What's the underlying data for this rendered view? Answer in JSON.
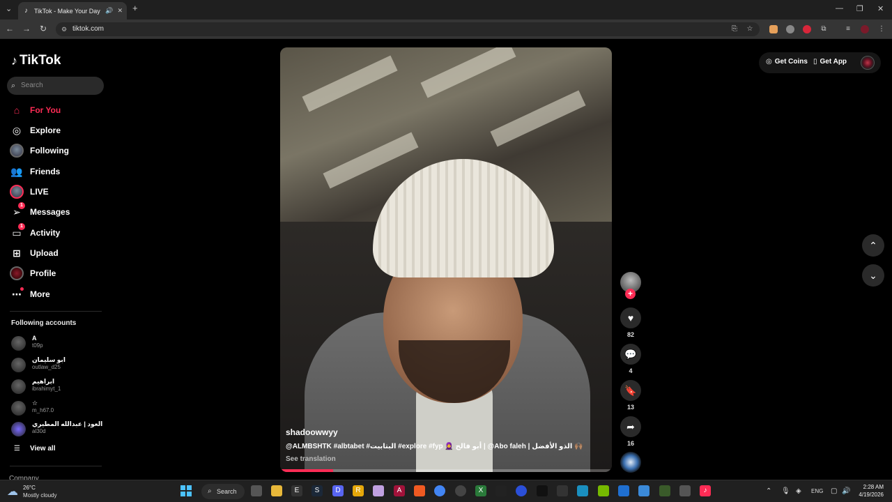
{
  "browser": {
    "tab_title": "TikTok - Make Your Day",
    "url": "tiktok.com"
  },
  "sidebar": {
    "logo": "TikTok",
    "search_placeholder": "Search",
    "nav": [
      {
        "label": "For You",
        "icon": "home-icon",
        "active": true
      },
      {
        "label": "Explore",
        "icon": "compass-icon"
      },
      {
        "label": "Following",
        "icon": "following-avatar"
      },
      {
        "label": "Friends",
        "icon": "friends-icon"
      },
      {
        "label": "LIVE",
        "icon": "live-avatar"
      },
      {
        "label": "Messages",
        "icon": "messages-icon",
        "badge": "1"
      },
      {
        "label": "Activity",
        "icon": "activity-icon",
        "badge": "1"
      },
      {
        "label": "Upload",
        "icon": "upload-icon"
      },
      {
        "label": "Profile",
        "icon": "profile-avatar"
      },
      {
        "label": "More",
        "icon": "more-icon"
      }
    ],
    "following_title": "Following accounts",
    "accounts": [
      {
        "name": "A",
        "handle": "t09p"
      },
      {
        "name": "ابو سليمان",
        "handle": "outlaw_d25"
      },
      {
        "name": "ابراهيم",
        "handle": "ibrahimyt_1"
      },
      {
        "name": "☆",
        "handle": "m_h67.0"
      },
      {
        "name": "العود | عبدالله المطيري",
        "handle": "al30d"
      }
    ],
    "view_all": "View all",
    "company": "Company"
  },
  "header": {
    "get_coins": "Get Coins",
    "get_app": "Get App"
  },
  "video": {
    "username": "shadoowwyy",
    "caption": "@ALMBSHTK #albtabet #البتابيت #explore #fyp  🧕 أبو فالح | @Abo faleh | الذو الأفضل 🙌🏽",
    "see_translation": "See translation",
    "progress": 0.16
  },
  "actions": {
    "likes": "82",
    "comments": "4",
    "saves": "13",
    "shares": "16"
  },
  "taskbar": {
    "temp": "26°C",
    "weather": "Mostly cloudy",
    "search": "Search",
    "lang": "ENG",
    "time": "2:28 AM",
    "date": "4/19/2026"
  }
}
